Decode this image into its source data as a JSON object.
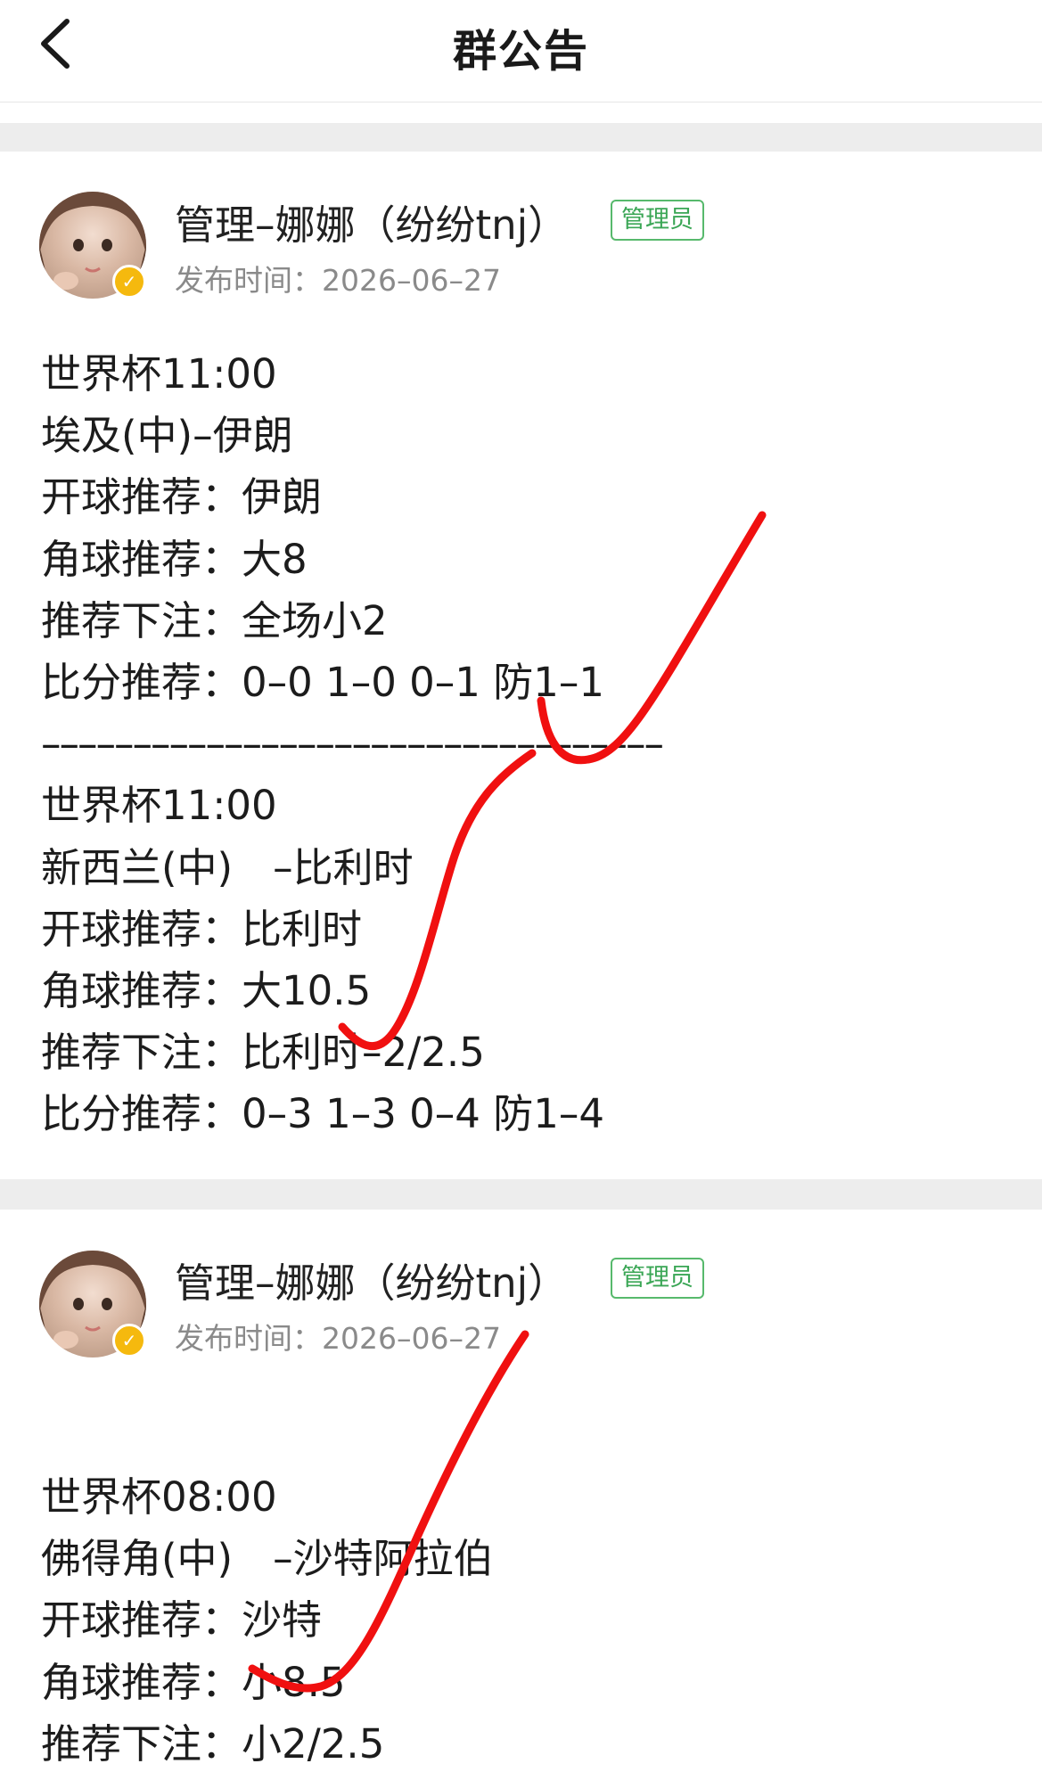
{
  "header": {
    "title": "群公告",
    "back_icon": "chevron-left-icon"
  },
  "announcements": [
    {
      "author": "管理–娜娜（纷纷tnj）",
      "role_badge": "管理员",
      "publish_label": "发布时间：",
      "publish_date": "2026–06–27",
      "lines": [
        "世界杯11:00",
        "埃及(中)–伊朗",
        "开球推荐：伊朗",
        "角球推荐：大8",
        "推荐下注：全场小2",
        "比分推荐：0–0 1–0 0–1 防1–1",
        "––––––––––––––––––––––––––––––––––",
        "世界杯11:00",
        "新西兰(中)　–比利时",
        "开球推荐：比利时",
        "角球推荐：大10.5",
        "推荐下注：比利时–2/2.5",
        "比分推荐：0–3 1–3 0–4 防1–4"
      ]
    },
    {
      "author": "管理–娜娜（纷纷tnj）",
      "role_badge": "管理员",
      "publish_label": "发布时间：",
      "publish_date": "2026–06–27",
      "lines": [
        "世界杯08:00",
        "佛得角(中)　–沙特阿拉伯",
        "开球推荐：沙特",
        "角球推荐：小8.5",
        "推荐下注：小2/2.5"
      ]
    }
  ],
  "colors": {
    "accent_green": "#3aa655",
    "badge_yellow": "#f5b90e",
    "annotation_red": "#f01010",
    "separator_gray": "#ededed"
  }
}
